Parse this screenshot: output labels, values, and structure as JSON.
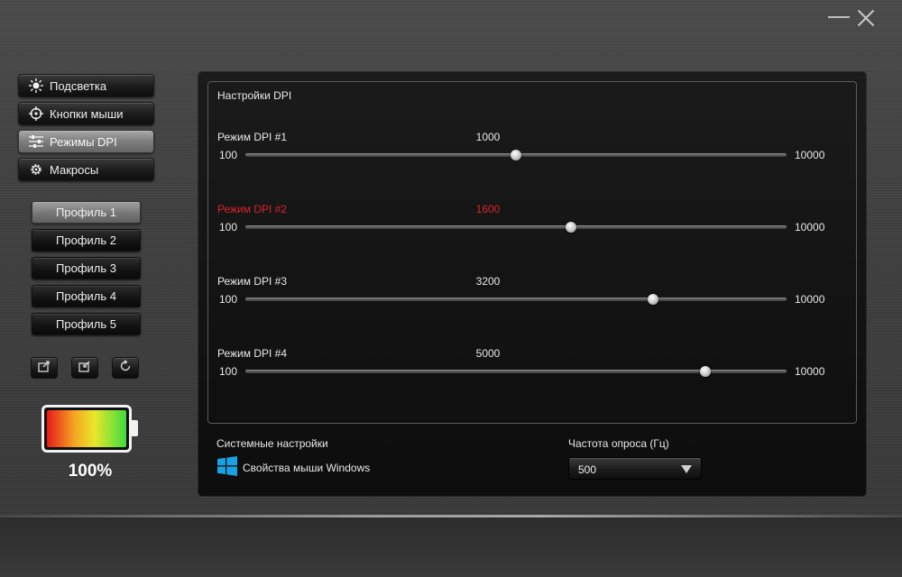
{
  "sidebar": {
    "nav": [
      {
        "label": "Подсветка",
        "icon": "sun-icon",
        "active": false
      },
      {
        "label": "Кнопки мыши",
        "icon": "crosshair-icon",
        "active": false
      },
      {
        "label": "Режимы DPI",
        "icon": "sliders-icon",
        "active": true
      },
      {
        "label": "Макросы",
        "icon": "gear-icon",
        "active": false
      }
    ],
    "profiles": [
      {
        "label": "Профиль 1",
        "active": true
      },
      {
        "label": "Профиль 2",
        "active": false
      },
      {
        "label": "Профиль 3",
        "active": false
      },
      {
        "label": "Профиль 4",
        "active": false
      },
      {
        "label": "Профиль 5",
        "active": false
      }
    ],
    "tools": [
      "import-icon",
      "export-icon",
      "reset-icon"
    ],
    "battery": {
      "percent_label": "100%",
      "level": 1.0
    }
  },
  "dpi_settings": {
    "title": "Настройки DPI",
    "min_label": "100",
    "max_label": "10000",
    "min": 100,
    "max": 10000,
    "modes": [
      {
        "label": "Режим DPI #1",
        "value": "1000",
        "highlight": false
      },
      {
        "label": "Режим DPI #2",
        "value": "1600",
        "highlight": true
      },
      {
        "label": "Режим DPI #3",
        "value": "3200",
        "highlight": false
      },
      {
        "label": "Режим DPI #4",
        "value": "5000",
        "highlight": false
      }
    ],
    "highlight_color": "#d8232a"
  },
  "system": {
    "title": "Системные настройки",
    "windows_link": "Свойства мыши Windows"
  },
  "polling": {
    "title": "Частота опроса (Гц)",
    "selected": "500"
  }
}
